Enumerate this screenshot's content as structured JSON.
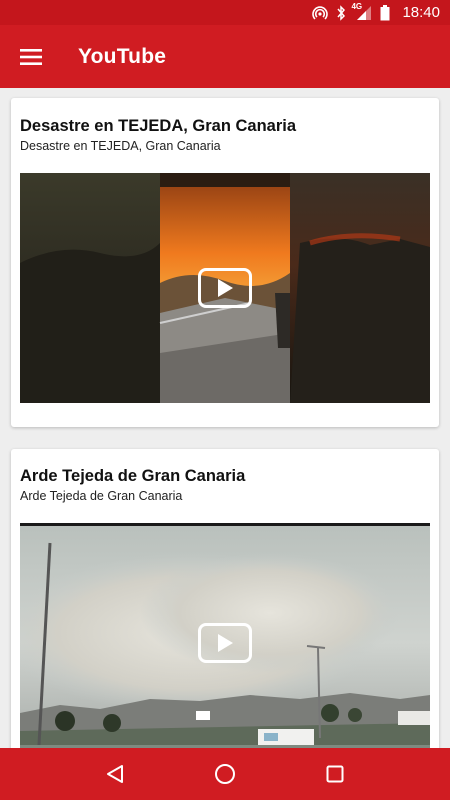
{
  "status_bar": {
    "time": "18:40",
    "network_label": "4G",
    "icons": [
      "hotspot-icon",
      "bluetooth-icon",
      "signal-icon",
      "battery-icon"
    ]
  },
  "app_bar": {
    "title": "YouTube",
    "menu_icon": "hamburger-menu-icon",
    "background_color": "#d01c22"
  },
  "videos": [
    {
      "title": "Desastre en TEJEDA, Gran Canaria",
      "subtitle": "Desastre en TEJEDA, Gran Canaria",
      "thumbnail": "wildfire-on-hillside-road-vertical-video"
    },
    {
      "title": "Arde Tejeda de Gran Canaria",
      "subtitle": "Arde Tejeda de Gran Canaria",
      "thumbnail": "smoke-plume-over-mountains-highway"
    }
  ],
  "nav_bar": {
    "items": [
      "back-icon",
      "home-icon",
      "recents-icon"
    ],
    "background_color": "#d01c22"
  }
}
